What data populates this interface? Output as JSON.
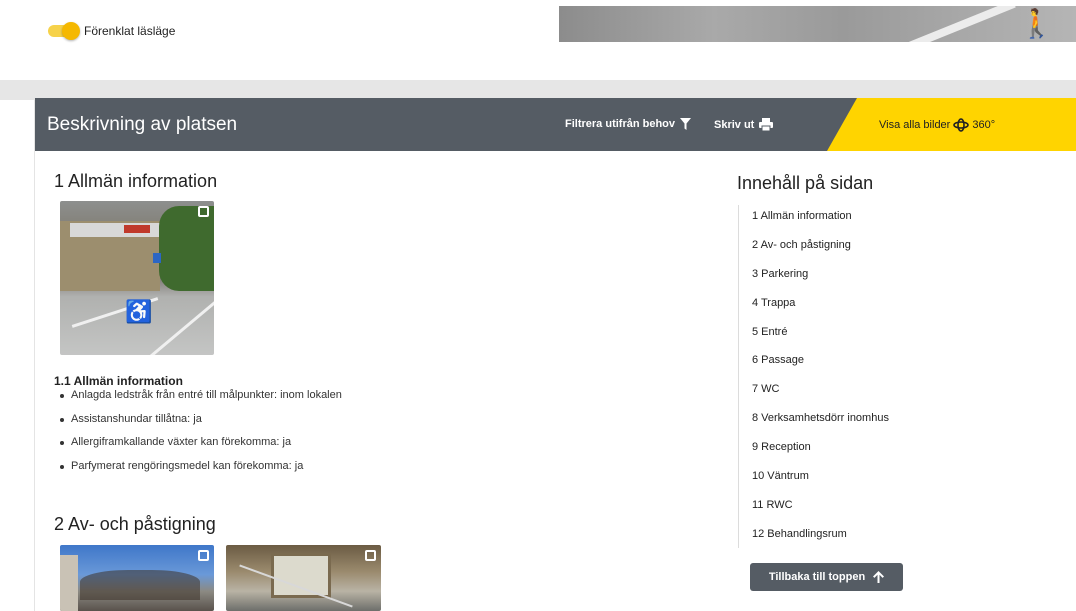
{
  "top": {
    "toggle_label": "Förenklat läsläge"
  },
  "header": {
    "title": "Beskrivning av platsen",
    "filter_label": "Filtrera utifrån behov",
    "print_label": "Skriv ut",
    "all_images_label": "Visa alla bilder",
    "view360_label": "360°"
  },
  "sections": {
    "s1": {
      "title": "1 Allmän information",
      "sub_title": "1.1 Allmän information",
      "items": [
        "Anlagda ledstråk från entré till målpunkter: inom lokalen",
        "Assistanshundar tillåtna: ja",
        "Allergiframkallande växter kan förekomma: ja",
        "Parfymerat rengöringsmedel kan förekomma: ja"
      ]
    },
    "s2": {
      "title": "2 Av- och påstigning"
    }
  },
  "toc": {
    "title": "Innehåll på sidan",
    "items": [
      "1 Allmän information",
      "2 Av- och påstigning",
      "3 Parkering",
      "4 Trappa",
      "5 Entré",
      "6 Passage",
      "7 WC",
      "8 Verksamhetsdörr inomhus",
      "9 Reception",
      "10 Väntrum",
      "11 RWC",
      "12 Behandlingsrum"
    ],
    "back_to_top": "Tillbaka till toppen"
  },
  "colors": {
    "header_bg": "#555c64",
    "accent_yellow": "#ffd400",
    "toggle": "#f5b800"
  }
}
